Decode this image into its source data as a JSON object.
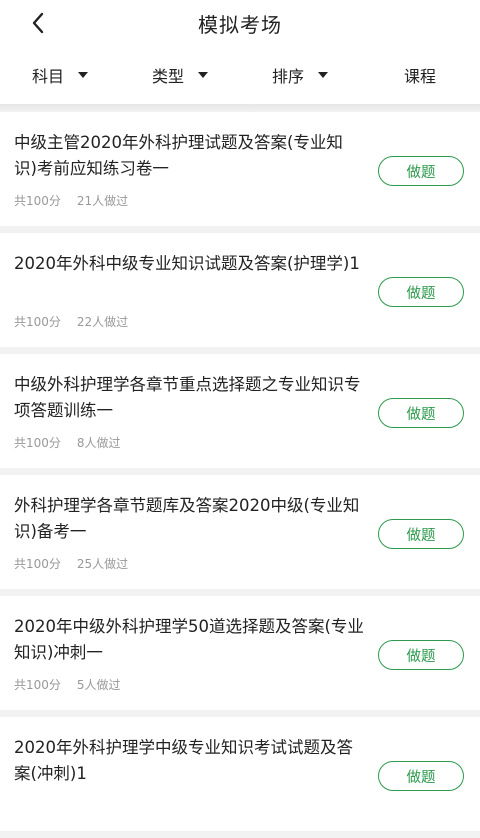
{
  "header": {
    "title": "模拟考场"
  },
  "filters": [
    {
      "label": "科目",
      "dropdown": true
    },
    {
      "label": "类型",
      "dropdown": true
    },
    {
      "label": "排序",
      "dropdown": true
    },
    {
      "label": "课程",
      "dropdown": false
    }
  ],
  "exams": [
    {
      "title": "中级主管2020年外科护理试题及答案(专业知识)考前应知练习卷一",
      "total": "共100分",
      "done": "21人做过",
      "button": "做题"
    },
    {
      "title": "2020年外科中级专业知识试题及答案(护理学)1",
      "total": "共100分",
      "done": "22人做过",
      "button": "做题"
    },
    {
      "title": "中级外科护理学各章节重点选择题之专业知识专项答题训练一",
      "total": "共100分",
      "done": "8人做过",
      "button": "做题"
    },
    {
      "title": "外科护理学各章节题库及答案2020中级(专业知识)备考一",
      "total": "共100分",
      "done": "25人做过",
      "button": "做题"
    },
    {
      "title": "2020年中级外科护理学50道选择题及答案(专业知识)冲刺一",
      "total": "共100分",
      "done": "5人做过",
      "button": "做题"
    },
    {
      "title": "2020年外科护理学中级专业知识考试试题及答案(冲刺)1",
      "total": "",
      "done": "",
      "button": "做题"
    }
  ],
  "colors": {
    "accent": "#2d9a4d",
    "meta": "#999999"
  }
}
